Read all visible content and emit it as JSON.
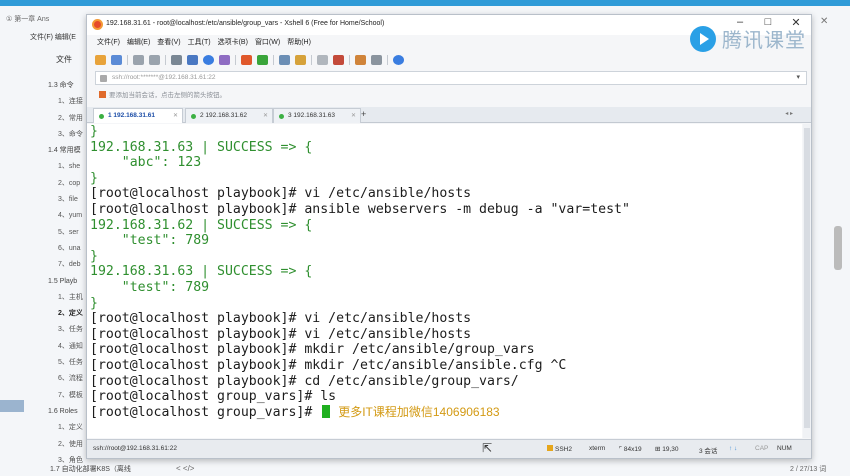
{
  "bg_doc": {
    "title": "① 第一章 Ans",
    "menu": "文件(F) 编辑(E",
    "menu2": "文件",
    "close": "✕",
    "toc": [
      {
        "label": "1.3 命令",
        "type": "sec"
      },
      {
        "label": "1、连接",
        "type": "item"
      },
      {
        "label": "2、常用",
        "type": "item"
      },
      {
        "label": "3、命令",
        "type": "item"
      },
      {
        "label": "1.4 常用模",
        "type": "sec"
      },
      {
        "label": "1、she",
        "type": "item"
      },
      {
        "label": "2、cop",
        "type": "item"
      },
      {
        "label": "3、file",
        "type": "item"
      },
      {
        "label": "4、yum",
        "type": "item"
      },
      {
        "label": "5、ser",
        "type": "item"
      },
      {
        "label": "6、una",
        "type": "item"
      },
      {
        "label": "7、deb",
        "type": "item"
      },
      {
        "label": "1.5 Playb",
        "type": "sec"
      },
      {
        "label": "1、主机",
        "type": "item"
      },
      {
        "label": "2、定义",
        "type": "bold"
      },
      {
        "label": "3、任务",
        "type": "item"
      },
      {
        "label": "4、通知",
        "type": "item"
      },
      {
        "label": "5、任务",
        "type": "item"
      },
      {
        "label": "6、流程",
        "type": "item"
      },
      {
        "label": "7、模板",
        "type": "item"
      },
      {
        "label": "1.6 Roles",
        "type": "sec"
      },
      {
        "label": "1、定义",
        "type": "item"
      },
      {
        "label": "2、使用",
        "type": "item"
      },
      {
        "label": "3、角色",
        "type": "item"
      }
    ],
    "bottom_item": "1.7 自动化部署K8S（离线",
    "nav": "<   </>",
    "pages": "2 / 27/13 词"
  },
  "xshell": {
    "title": "192.168.31.61 - root@localhost:/etc/ansible/group_vars - Xshell 6 (Free for Home/School)",
    "controls": {
      "minimize": "–",
      "maximize": "□",
      "close": "✕"
    },
    "menu": [
      "文件(F)",
      "编辑(E)",
      "查看(V)",
      "工具(T)",
      "选项卡(B)",
      "窗口(W)",
      "帮助(H)"
    ],
    "address": "ssh://root:*******@192.168.31.61:22",
    "hint": "要添加当前会话，点击左侧的箭头按钮。",
    "tabs": [
      {
        "label": "1 192.168.31.61",
        "active": true
      },
      {
        "label": "2 192.168.31.62",
        "active": false
      },
      {
        "label": "3 192.168.31.63",
        "active": false
      }
    ],
    "tab_add": "+",
    "tab_arrows": "◂ ▸",
    "status": {
      "conn": "ssh://root@192.168.31.61:22",
      "proto": "SSH2",
      "term": "xterm",
      "size": "84x19",
      "pos": "19,30",
      "sessions": "3 会话",
      "caps": "CAP",
      "num": "NUM"
    }
  },
  "terminal": {
    "lines": [
      {
        "text": "}",
        "kind": "ok"
      },
      {
        "text": "192.168.31.63 | SUCCESS => {",
        "kind": "ok"
      },
      {
        "text": "    \"abc\": 123",
        "kind": "ok"
      },
      {
        "text": "}",
        "kind": "ok"
      },
      {
        "text": "[root@localhost playbook]# vi /etc/ansible/hosts",
        "kind": "cmd"
      },
      {
        "text": "[root@localhost playbook]# ansible webservers -m debug -a \"var=test\"",
        "kind": "cmd"
      },
      {
        "text": "192.168.31.62 | SUCCESS => {",
        "kind": "ok"
      },
      {
        "text": "    \"test\": 789",
        "kind": "ok"
      },
      {
        "text": "}",
        "kind": "ok"
      },
      {
        "text": "192.168.31.63 | SUCCESS => {",
        "kind": "ok"
      },
      {
        "text": "    \"test\": 789",
        "kind": "ok"
      },
      {
        "text": "}",
        "kind": "ok"
      },
      {
        "text": "[root@localhost playbook]# vi /etc/ansible/hosts",
        "kind": "cmd"
      },
      {
        "text": "[root@localhost playbook]# vi /etc/ansible/hosts",
        "kind": "cmd"
      },
      {
        "text": "[root@localhost playbook]# mkdir /etc/ansible/group_vars",
        "kind": "cmd"
      },
      {
        "text": "[root@localhost playbook]# mkdir /etc/ansible/ansible.cfg ^C",
        "kind": "cmd"
      },
      {
        "text": "[root@localhost playbook]# cd /etc/ansible/group_vars/",
        "kind": "cmd"
      },
      {
        "text": "[root@localhost group_vars]# ls",
        "kind": "cmd"
      }
    ],
    "prompt": "[root@localhost group_vars]# ",
    "ad_text": "更多IT课程加微信1406906183"
  },
  "watermark": "腾讯课堂",
  "colors": {
    "success_green": "#2f8f2f",
    "cursor_green": "#20b020",
    "ad_gold": "#d39a14",
    "accent_blue": "#2f9bd8"
  }
}
